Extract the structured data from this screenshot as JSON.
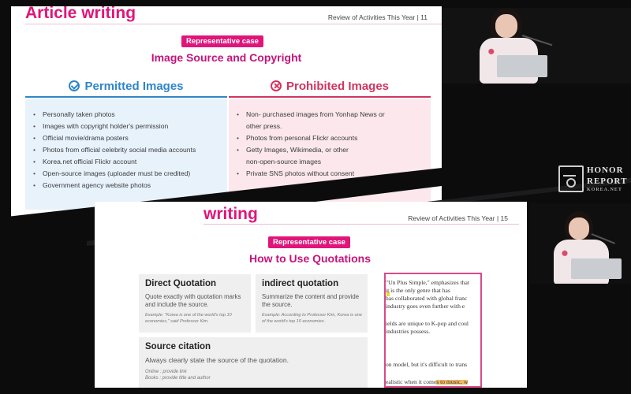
{
  "slide1": {
    "title": "Article writing",
    "header": "Review of Activities This Year  |  11",
    "tag": "Representative case",
    "subtitle": "Image Source and Copyright",
    "permitted": {
      "heading": "Permitted Images",
      "icon": "check-circle-icon",
      "color": "#2f86c8",
      "items": [
        "Personally taken photos",
        "Images with copyright holder's permission",
        "Official movie/drama posters",
        "Photos from official celebrity social media accounts",
        "Korea.net official Flickr account",
        "Open-source images (uploader must be credited)",
        "Government agency website photos"
      ]
    },
    "prohibited": {
      "heading": "Prohibited Images",
      "icon": "x-circle-icon",
      "color": "#d0355f",
      "items": [
        "Non- purchased images from Yonhap News or",
        "other press.",
        "Photos from personal Flickr accounts",
        "Getty Images, Wikimedia, or other",
        "non-open-source images",
        "Private SNS photos without consent"
      ]
    }
  },
  "slide2": {
    "title": "writing",
    "header": "Review of Activities This Year  |  15",
    "tag": "Representative case",
    "subtitle": "How to Use Quotations",
    "direct": {
      "title": "Direct Quotation",
      "desc": "Quote exactly with quotation marks and include the source.",
      "example": "Example: \"Korea is one of the world's top 10 economies,\" said Professor Kim."
    },
    "indirect": {
      "title": "indirect quotation",
      "desc": "Summarize the content and provide the source.",
      "example": "Example: According to Professor Kim, Korea is one of the world's top 10 economies."
    },
    "source": {
      "title": "Source citation",
      "desc": "Always clearly state the source of the quotation.",
      "online": "Online : provide link",
      "books": "Books : provide title and author"
    },
    "clipping": [
      "\"Un Plus Simple,\" emphasizes that",
      "it is the only genre that has",
      "has collaborated with global franc",
      "industry goes even further with e",
      "",
      "ields are unique to K-pop and coul",
      "industries possess.",
      "",
      "",
      "on model, but it's difficult to trans",
      "",
      "ealistic when it comes to music, w"
    ]
  },
  "branding": {
    "line1": "HONOR",
    "line2": "REPORT",
    "line3": "KOREA.NET"
  },
  "colors": {
    "accent": "#e0157a",
    "background": "#0c0c0d"
  }
}
